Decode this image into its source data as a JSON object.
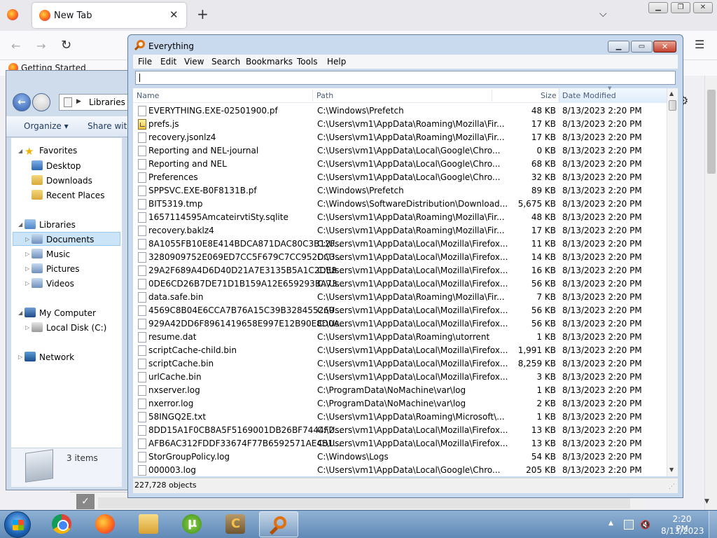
{
  "firefox": {
    "tab_title": "New Tab",
    "bookmark": "Getting Started"
  },
  "explorer": {
    "address": "Libraries",
    "organize": "Organize ▾",
    "share": "Share with",
    "tree": {
      "favorites": "Favorites",
      "desktop": "Desktop",
      "downloads": "Downloads",
      "recent": "Recent Places",
      "libraries": "Libraries",
      "documents": "Documents",
      "music": "Music",
      "pictures": "Pictures",
      "videos": "Videos",
      "computer": "My Computer",
      "disk": "Local Disk (C:)",
      "network": "Network"
    },
    "status": "3 items"
  },
  "everything": {
    "title": "Everything",
    "menu": [
      "File",
      "Edit",
      "View",
      "Search",
      "Bookmarks",
      "Tools",
      "Help"
    ],
    "search_value": "",
    "columns": {
      "name": "Name",
      "path": "Path",
      "size": "Size",
      "date": "Date Modified"
    },
    "rows": [
      {
        "name": "EVERYTHING.EXE-02501900.pf",
        "path": "C:\\Windows\\Prefetch",
        "size": "48 KB",
        "date": "8/13/2023 2:20 PM",
        "icon": "file"
      },
      {
        "name": "prefs.js",
        "path": "C:\\Users\\vm1\\AppData\\Roaming\\Mozilla\\Fir...",
        "size": "17 KB",
        "date": "8/13/2023 2:20 PM",
        "icon": "js"
      },
      {
        "name": "recovery.jsonlz4",
        "path": "C:\\Users\\vm1\\AppData\\Roaming\\Mozilla\\Fir...",
        "size": "17 KB",
        "date": "8/13/2023 2:20 PM",
        "icon": "file"
      },
      {
        "name": "Reporting and NEL-journal",
        "path": "C:\\Users\\vm1\\AppData\\Local\\Google\\Chro...",
        "size": "0 KB",
        "date": "8/13/2023 2:20 PM",
        "icon": "file"
      },
      {
        "name": "Reporting and NEL",
        "path": "C:\\Users\\vm1\\AppData\\Local\\Google\\Chro...",
        "size": "68 KB",
        "date": "8/13/2023 2:20 PM",
        "icon": "file"
      },
      {
        "name": "Preferences",
        "path": "C:\\Users\\vm1\\AppData\\Local\\Google\\Chro...",
        "size": "32 KB",
        "date": "8/13/2023 2:20 PM",
        "icon": "file"
      },
      {
        "name": "SPPSVC.EXE-B0F8131B.pf",
        "path": "C:\\Windows\\Prefetch",
        "size": "89 KB",
        "date": "8/13/2023 2:20 PM",
        "icon": "file"
      },
      {
        "name": "BIT5319.tmp",
        "path": "C:\\Windows\\SoftwareDistribution\\Download...",
        "size": "5,675 KB",
        "date": "8/13/2023 2:20 PM",
        "icon": "file"
      },
      {
        "name": "1657114595AmcateirvtiSty.sqlite",
        "path": "C:\\Users\\vm1\\AppData\\Roaming\\Mozilla\\Fir...",
        "size": "48 KB",
        "date": "8/13/2023 2:20 PM",
        "icon": "file"
      },
      {
        "name": "recovery.baklz4",
        "path": "C:\\Users\\vm1\\AppData\\Roaming\\Mozilla\\Fir...",
        "size": "17 KB",
        "date": "8/13/2023 2:20 PM",
        "icon": "file"
      },
      {
        "name": "8A1055FB10E8E414BDCA871DAC80C3B12F...",
        "path": "C:\\Users\\vm1\\AppData\\Local\\Mozilla\\Firefox...",
        "size": "11 KB",
        "date": "8/13/2023 2:20 PM",
        "icon": "file"
      },
      {
        "name": "3280909752E069ED7CC5F679C7CC952DC3...",
        "path": "C:\\Users\\vm1\\AppData\\Local\\Mozilla\\Firefox...",
        "size": "14 KB",
        "date": "8/13/2023 2:20 PM",
        "icon": "file"
      },
      {
        "name": "29A2F689A4D6D40D21A7E3135B5A1C2DE8...",
        "path": "C:\\Users\\vm1\\AppData\\Local\\Mozilla\\Firefox...",
        "size": "16 KB",
        "date": "8/13/2023 2:20 PM",
        "icon": "file"
      },
      {
        "name": "0DE6CD26B7DE71D1B159A12E659293BA73...",
        "path": "C:\\Users\\vm1\\AppData\\Local\\Mozilla\\Firefox...",
        "size": "56 KB",
        "date": "8/13/2023 2:20 PM",
        "icon": "file"
      },
      {
        "name": "data.safe.bin",
        "path": "C:\\Users\\vm1\\AppData\\Roaming\\Mozilla\\Fir...",
        "size": "7 KB",
        "date": "8/13/2023 2:20 PM",
        "icon": "file"
      },
      {
        "name": "4569C8B04E6CCA7B76A15C39B328455269...",
        "path": "C:\\Users\\vm1\\AppData\\Local\\Mozilla\\Firefox...",
        "size": "56 KB",
        "date": "8/13/2023 2:20 PM",
        "icon": "file"
      },
      {
        "name": "929A42DD6F8961419658E997E12B90E8D0A...",
        "path": "C:\\Users\\vm1\\AppData\\Local\\Mozilla\\Firefox...",
        "size": "56 KB",
        "date": "8/13/2023 2:20 PM",
        "icon": "file"
      },
      {
        "name": "resume.dat",
        "path": "C:\\Users\\vm1\\AppData\\Roaming\\utorrent",
        "size": "1 KB",
        "date": "8/13/2023 2:20 PM",
        "icon": "file"
      },
      {
        "name": "scriptCache-child.bin",
        "path": "C:\\Users\\vm1\\AppData\\Local\\Mozilla\\Firefox...",
        "size": "1,991 KB",
        "date": "8/13/2023 2:20 PM",
        "icon": "file"
      },
      {
        "name": "scriptCache.bin",
        "path": "C:\\Users\\vm1\\AppData\\Local\\Mozilla\\Firefox...",
        "size": "8,259 KB",
        "date": "8/13/2023 2:20 PM",
        "icon": "file"
      },
      {
        "name": "urlCache.bin",
        "path": "C:\\Users\\vm1\\AppData\\Local\\Mozilla\\Firefox...",
        "size": "3 KB",
        "date": "8/13/2023 2:20 PM",
        "icon": "file"
      },
      {
        "name": "nxserver.log",
        "path": "C:\\ProgramData\\NoMachine\\var\\log",
        "size": "1 KB",
        "date": "8/13/2023 2:20 PM",
        "icon": "file"
      },
      {
        "name": "nxerror.log",
        "path": "C:\\ProgramData\\NoMachine\\var\\log",
        "size": "2 KB",
        "date": "8/13/2023 2:20 PM",
        "icon": "file"
      },
      {
        "name": "58INGQ2E.txt",
        "path": "C:\\Users\\vm1\\AppData\\Roaming\\Microsoft\\...",
        "size": "1 KB",
        "date": "8/13/2023 2:20 PM",
        "icon": "file"
      },
      {
        "name": "8DD15A1F0CB8A5F5169001DB26BF7444F2...",
        "path": "C:\\Users\\vm1\\AppData\\Local\\Mozilla\\Firefox...",
        "size": "13 KB",
        "date": "8/13/2023 2:20 PM",
        "icon": "file"
      },
      {
        "name": "AFB6AC312FDDF33674F77B6592571AE4B1...",
        "path": "C:\\Users\\vm1\\AppData\\Local\\Mozilla\\Firefox...",
        "size": "13 KB",
        "date": "8/13/2023 2:20 PM",
        "icon": "file"
      },
      {
        "name": "StorGroupPolicy.log",
        "path": "C:\\Windows\\Logs",
        "size": "54 KB",
        "date": "8/13/2023 2:20 PM",
        "icon": "file"
      },
      {
        "name": "000003.log",
        "path": "C:\\Users\\vm1\\AppData\\Local\\Google\\Chro...",
        "size": "205 KB",
        "date": "8/13/2023 2:20 PM",
        "icon": "file"
      }
    ],
    "status": "227,728 objects"
  },
  "taskbar": {
    "time": "2:20 PM",
    "date": "8/13/2023"
  }
}
